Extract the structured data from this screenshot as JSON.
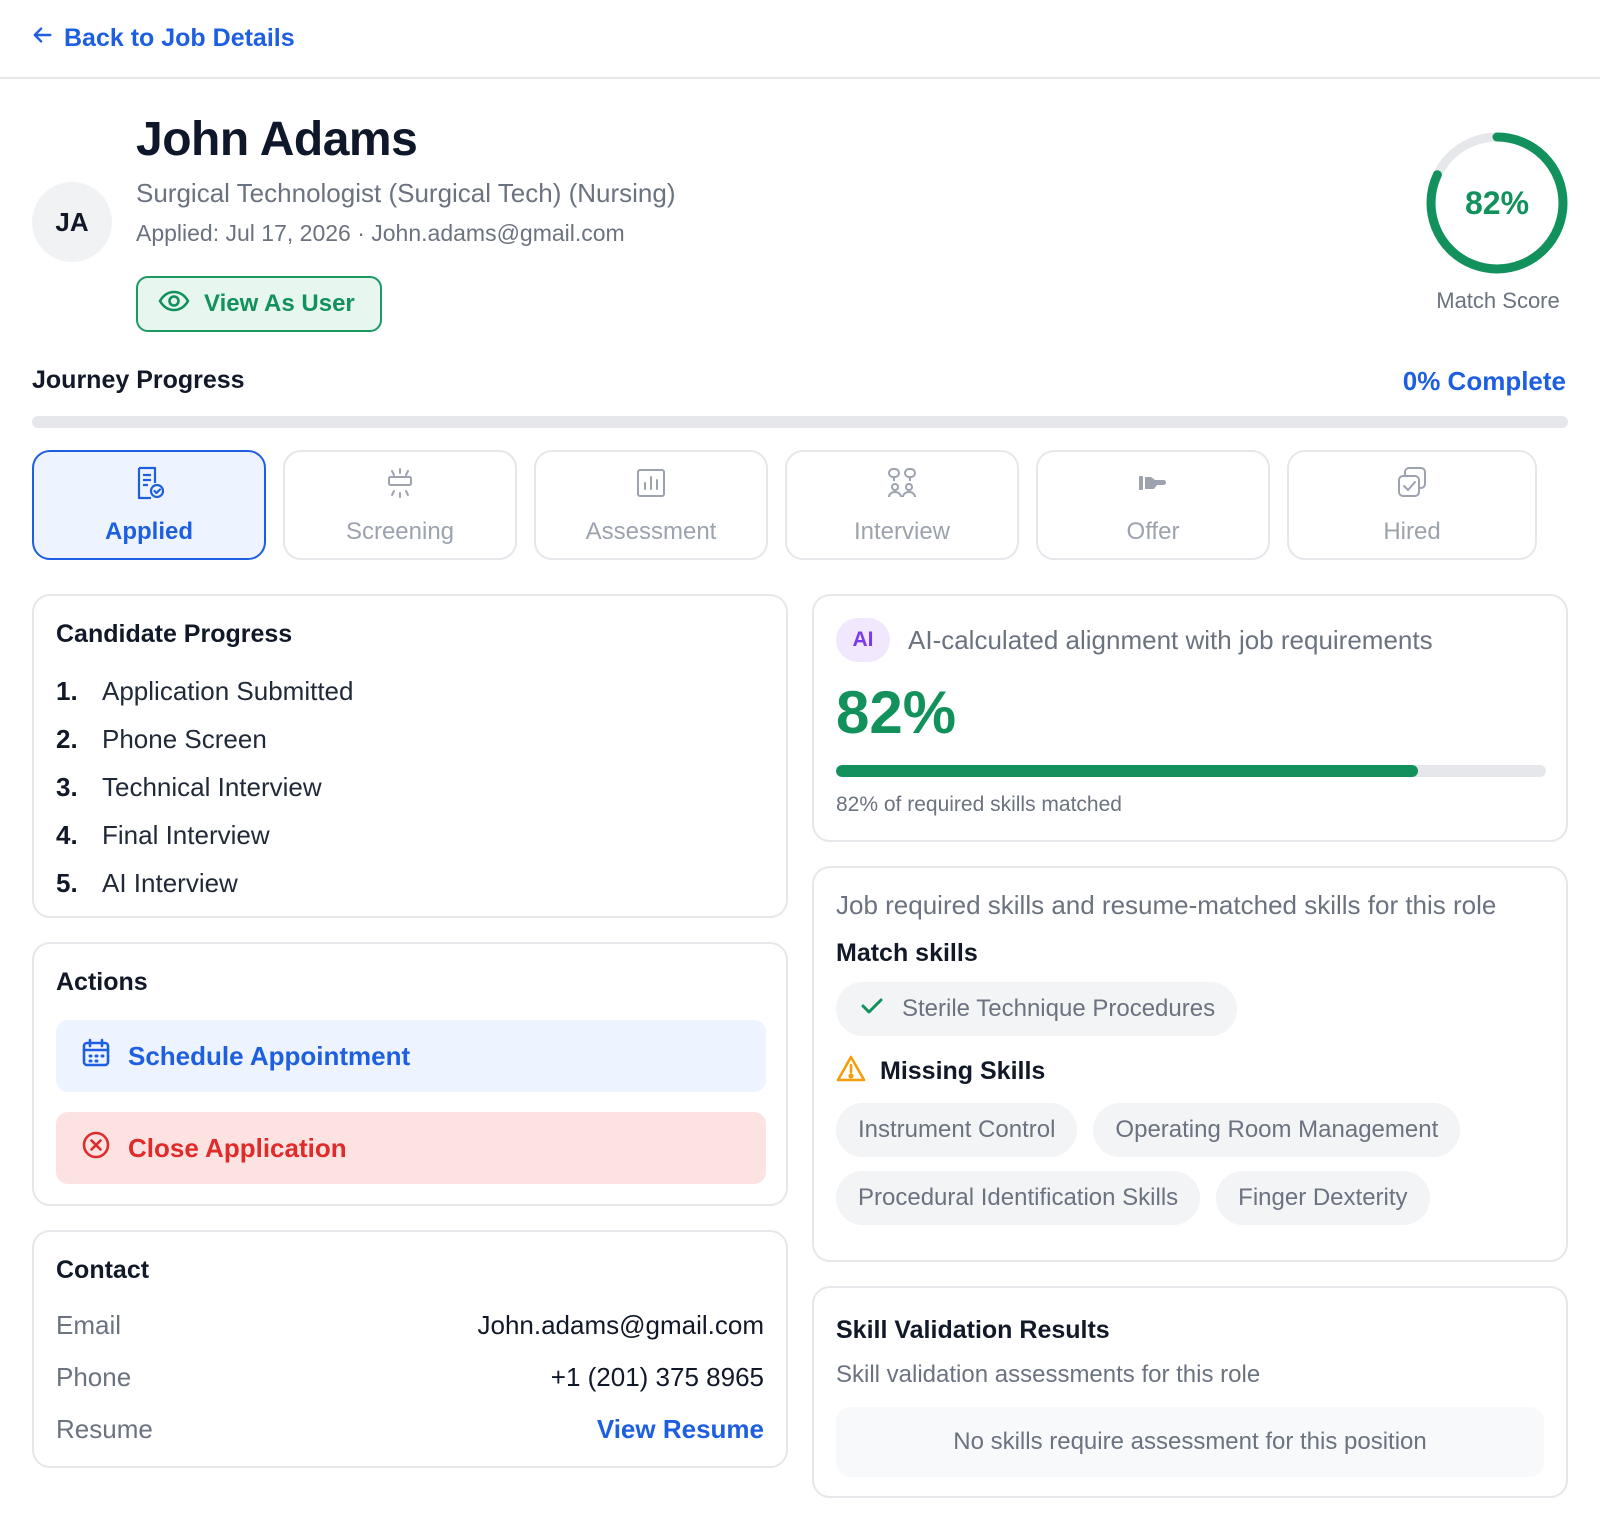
{
  "nav": {
    "back_label": "Back to Job Details"
  },
  "candidate": {
    "initials": "JA",
    "name": "John Adams",
    "role": "Surgical Technologist (Surgical Tech) (Nursing)",
    "applied_line": "Applied: Jul 17, 2026 · John.adams@gmail.com",
    "view_as_user_label": "View As User"
  },
  "match_score": {
    "value_label": "82%",
    "value": 0.82,
    "label": "Match Score"
  },
  "journey": {
    "title": "Journey Progress",
    "complete_label": "0% Complete",
    "progress": 0,
    "stages": [
      {
        "label": "Applied",
        "icon": "document-check-icon",
        "active": true
      },
      {
        "label": "Screening",
        "icon": "screening-icon",
        "active": false
      },
      {
        "label": "Assessment",
        "icon": "bar-chart-icon",
        "active": false
      },
      {
        "label": "Interview",
        "icon": "people-icon",
        "active": false
      },
      {
        "label": "Offer",
        "icon": "handshake-icon",
        "active": false
      },
      {
        "label": "Hired",
        "icon": "copy-check-icon",
        "active": false
      }
    ]
  },
  "candidate_progress": {
    "title": "Candidate Progress",
    "steps": [
      {
        "num": "1.",
        "label": "Application Submitted"
      },
      {
        "num": "2.",
        "label": "Phone Screen"
      },
      {
        "num": "3.",
        "label": "Technical Interview"
      },
      {
        "num": "4.",
        "label": "Final Interview"
      },
      {
        "num": "5.",
        "label": "AI Interview"
      }
    ]
  },
  "actions": {
    "title": "Actions",
    "schedule_label": "Schedule Appointment",
    "close_label": "Close Application"
  },
  "contact": {
    "title": "Contact",
    "email_label": "Email",
    "email_value": "John.adams@gmail.com",
    "phone_label": "Phone",
    "phone_value": "+1 (201) 375 8965",
    "resume_label": "Resume",
    "resume_link": "View Resume"
  },
  "alignment": {
    "badge": "AI",
    "description": "AI-calculated alignment with job requirements",
    "value_label": "82%",
    "value": 0.82,
    "note": "82% of required skills matched"
  },
  "skills": {
    "description": "Job required skills and resume-matched skills for this role",
    "match_title": "Match skills",
    "matched": [
      "Sterile Technique Procedures"
    ],
    "missing_title": "Missing Skills",
    "missing": [
      "Instrument Control",
      "Operating Room Management",
      "Procedural Identification Skills",
      "Finger Dexterity"
    ]
  },
  "validation": {
    "title": "Skill Validation Results",
    "subtitle": "Skill validation assessments for this role",
    "empty_message": "No skills require assessment for this position"
  },
  "colors": {
    "primary": "#1d5fe0",
    "success": "#12915c",
    "danger": "#e02b2b",
    "warning": "#f59e0b",
    "ai_purple": "#7c3aed"
  }
}
